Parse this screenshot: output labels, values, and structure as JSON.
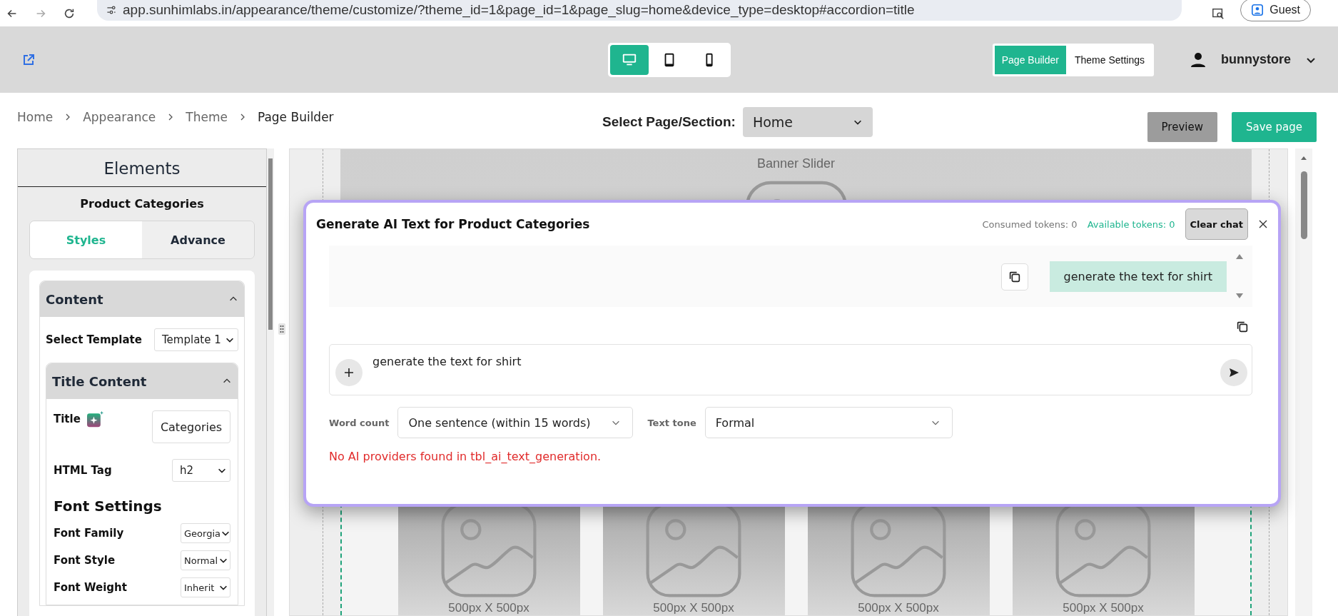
{
  "browser": {
    "url": "app.sunhimlabs.in/appearance/theme/customize/?theme_id=1&page_id=1&page_slug=home&device_type=desktop#accordion=title",
    "profile": "Guest"
  },
  "header": {
    "devices": [
      {
        "kind": "desktop",
        "selected": true
      },
      {
        "kind": "tablet",
        "selected": false
      },
      {
        "kind": "mobile",
        "selected": false
      }
    ],
    "modes": [
      {
        "label": "Page Builder",
        "selected": true
      },
      {
        "label": "Theme Settings",
        "selected": false
      }
    ],
    "user": "bunnystore"
  },
  "breadcrumb": [
    "Home",
    "Appearance",
    "Theme",
    "Page Builder"
  ],
  "page_select": {
    "label": "Select Page/Section:",
    "value": "Home"
  },
  "actions": [
    {
      "label": "Preview",
      "kind": "secondary"
    },
    {
      "label": "Save page",
      "kind": "primary"
    }
  ],
  "sidebar": {
    "title": "Elements",
    "subtitle": "Product Categories",
    "tabs": [
      {
        "label": "Styles",
        "selected": true
      },
      {
        "label": "Advance",
        "selected": false
      }
    ],
    "content": {
      "title": "Content",
      "expanded": true,
      "template_label": "Select Template",
      "template_value": "Template 1"
    },
    "title_content": {
      "title": "Title Content",
      "expanded": true,
      "fields": [
        {
          "kind": "ai-text",
          "label": "Title",
          "value": "Categories"
        },
        {
          "kind": "select",
          "label": "HTML Tag",
          "value": "h2"
        },
        {
          "kind": "heading",
          "label": "Font Settings"
        },
        {
          "kind": "small-select",
          "label": "Font Family",
          "value": "Georgia"
        },
        {
          "kind": "small-select",
          "label": "Font Style",
          "value": "Normal"
        },
        {
          "kind": "small-select",
          "label": "Font Weight",
          "value": "Inherit"
        }
      ]
    }
  },
  "canvas": {
    "banner_label": "Banner Slider",
    "products": [
      {
        "caption": "500px X 500px"
      },
      {
        "caption": "500px X 500px"
      },
      {
        "caption": "500px X 500px"
      },
      {
        "caption": "500px X 500px"
      }
    ]
  },
  "modal": {
    "title": "Generate AI Text for Product Categories",
    "consumed": "Consumed tokens: 0",
    "available": "Available tokens: 0",
    "clear_button": "Clear chat",
    "messages": [
      {
        "kind": "sent",
        "text": "generate the text for shirt"
      }
    ],
    "prompt_value": "generate the text for shirt",
    "word_count": {
      "label": "Word count",
      "value": "One sentence (within 15 words)"
    },
    "text_tone": {
      "label": "Text tone",
      "value": "Formal"
    },
    "error": "No AI providers found in tbl_ai_text_generation."
  }
}
